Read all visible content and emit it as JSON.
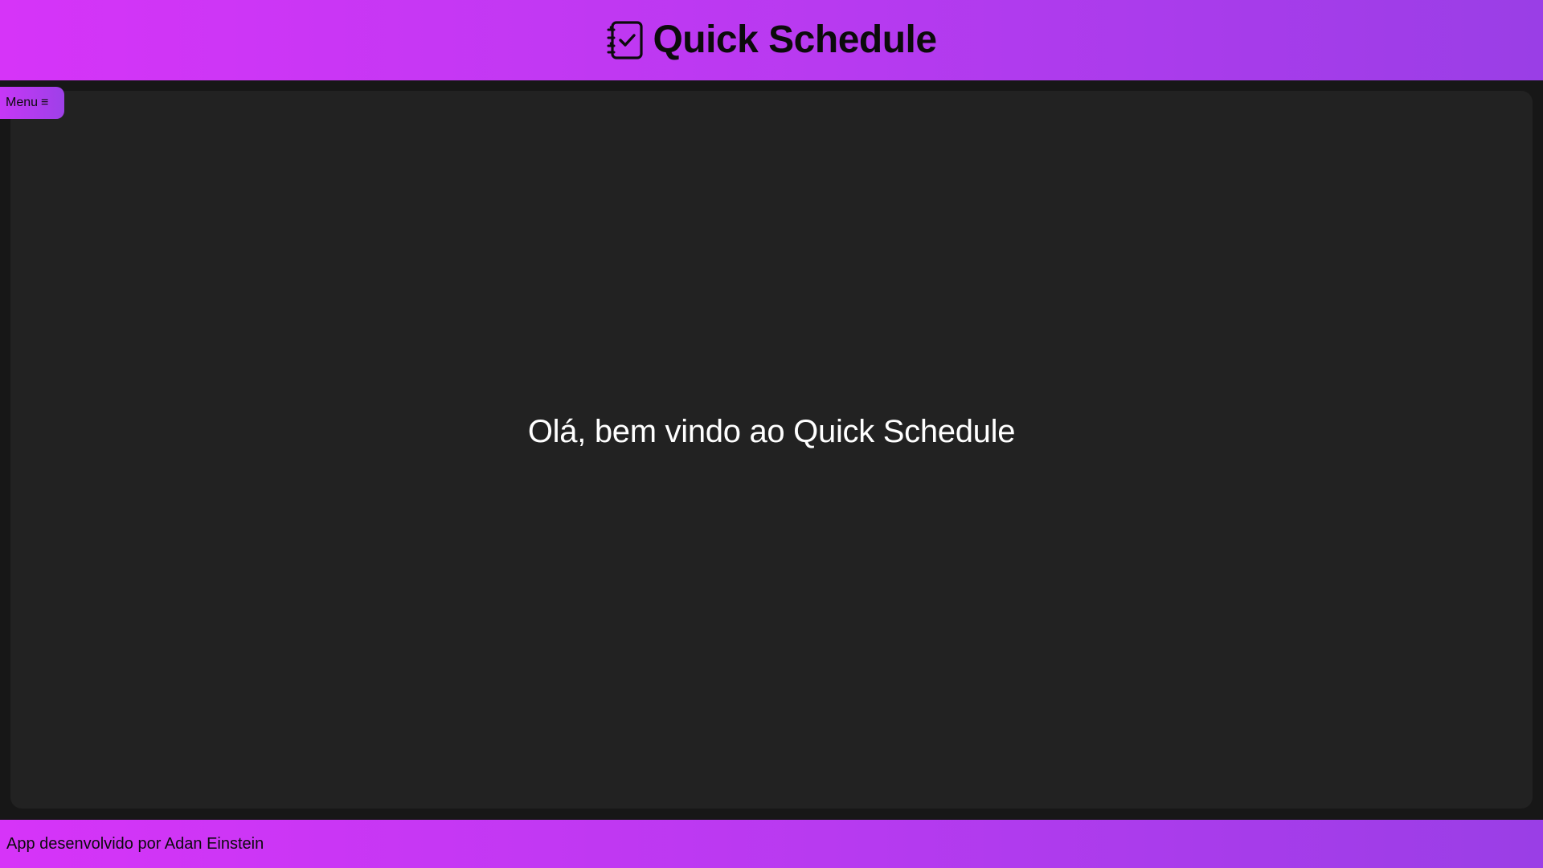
{
  "header": {
    "title": "Quick Schedule",
    "icon": "checklist-notebook-icon"
  },
  "menu": {
    "label": "Menu",
    "icon": "hamburger-icon",
    "icon_glyph": "≡"
  },
  "main": {
    "welcome_text": "Olá, bem vindo ao Quick Schedule"
  },
  "footer": {
    "credit": "App desenvolvido por Adan Einstein"
  },
  "colors": {
    "gradient_start": "#d634f8",
    "gradient_end": "#9a3ee6",
    "page_background": "#171717",
    "panel_background": "#222222",
    "text_dark": "#0b0b0b",
    "text_light": "#ffffff"
  }
}
